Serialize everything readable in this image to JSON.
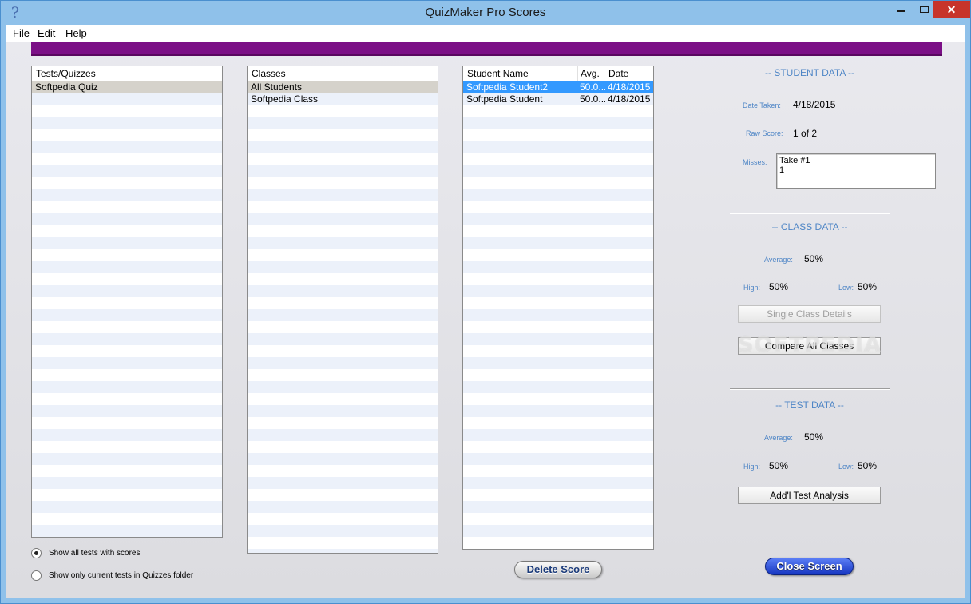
{
  "window": {
    "title": "QuizMaker Pro Scores",
    "controls": {
      "minimize": "minimize-icon",
      "maximize": "maximize-icon",
      "close": "✕"
    }
  },
  "menu": {
    "file": "File",
    "edit": "Edit",
    "help": "Help"
  },
  "colors": {
    "accent_bar": "#7b0f86",
    "section_title": "#4f86c6",
    "selection_blue": "#3399ff"
  },
  "tests_list": {
    "header": "Tests/Quizzes",
    "items": [
      "Softpedia Quiz"
    ]
  },
  "classes_list": {
    "header": "Classes",
    "items": [
      "All Students",
      "Softpedia Class"
    ]
  },
  "students_list": {
    "headers": {
      "name": "Student Name",
      "avg": "Avg.",
      "date": "Date"
    },
    "rows": [
      {
        "name": "Softpedia Student2",
        "avg": "50.0...",
        "date": "4/18/2015"
      },
      {
        "name": "Softpedia Student",
        "avg": "50.0...",
        "date": "4/18/2015"
      }
    ]
  },
  "filter_options": {
    "show_all": "Show all tests with scores",
    "show_current": "Show only current tests in Quizzes folder"
  },
  "buttons": {
    "delete_score": "Delete Score",
    "close_screen": "Close Screen",
    "single_class_details": "Single Class Details",
    "compare_all_classes": "Compare All Classes",
    "addl_test_analysis": "Add'l Test Analysis"
  },
  "student_data": {
    "title": "-- STUDENT DATA --",
    "date_taken_label": "Date Taken:",
    "date_taken": "4/18/2015",
    "raw_score_label": "Raw Score:",
    "raw_score": "1 of 2",
    "misses_label": "Misses:",
    "misses_line1": "Take #1",
    "misses_line2": "1"
  },
  "class_data": {
    "title": "-- CLASS DATA --",
    "average_label": "Average:",
    "average": "50%",
    "high_label": "High:",
    "high": "50%",
    "low_label": "Low:",
    "low": "50%"
  },
  "test_data": {
    "title": "-- TEST DATA --",
    "average_label": "Average:",
    "average": "50%",
    "high_label": "High:",
    "high": "50%",
    "low_label": "Low:",
    "low": "50%"
  },
  "watermark": "SOFTPEDIA"
}
